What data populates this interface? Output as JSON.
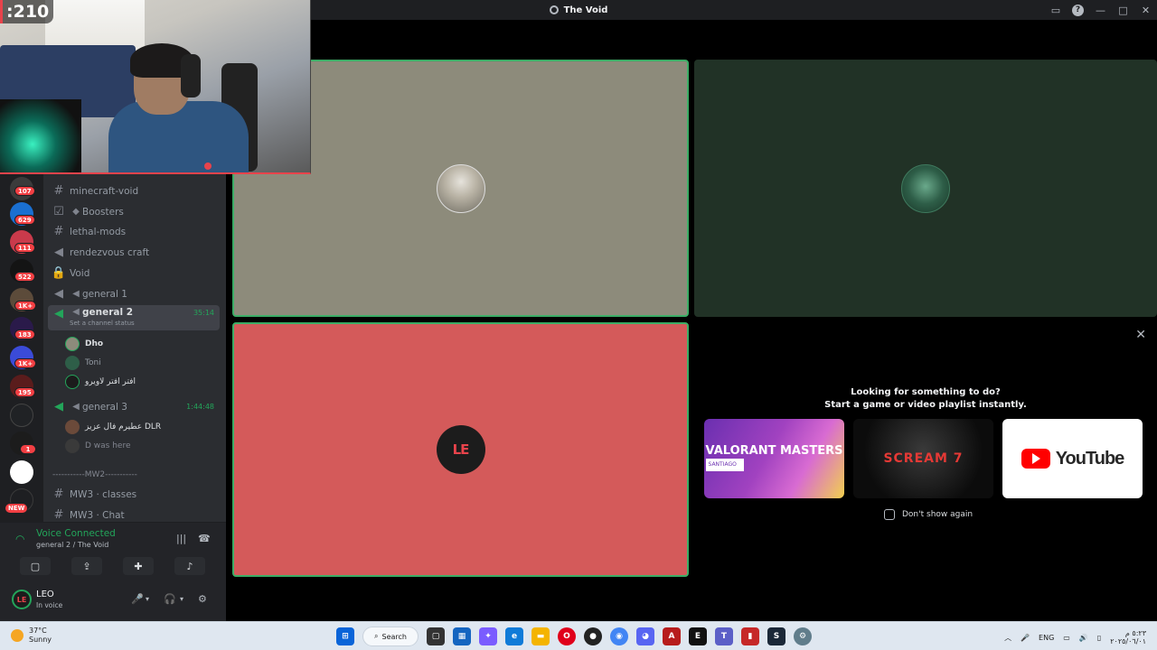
{
  "window": {
    "title": "The Void"
  },
  "stream": {
    "counter": ":210"
  },
  "rail_badges": [
    "107",
    "629",
    "111",
    "522",
    "1K+",
    "183",
    "1K+",
    "195",
    "1",
    "NEW"
  ],
  "channels": {
    "items": [
      {
        "name": "minecraft-void"
      },
      {
        "name": "Boosters"
      },
      {
        "name": "lethal-mods"
      },
      {
        "name": "rendezvous craft"
      },
      {
        "name": "Void"
      },
      {
        "name": "general 1"
      },
      {
        "name": "general 2",
        "status": "Set a channel status",
        "timer": "35:14"
      },
      {
        "name": "general 3",
        "timer": "1:44:48"
      },
      {
        "name": "MW3 · classes"
      },
      {
        "name": "MW3 · Chat"
      }
    ],
    "general2_members": [
      "Dho",
      "Toni",
      "افتر افتر لاويرو"
    ],
    "general3_members": [
      "عطيرم فال عزيز DLR",
      "D was here"
    ],
    "category": "-----------MW2-----------"
  },
  "voice": {
    "title": "Voice Connected",
    "subtitle": "general 2 / The Void"
  },
  "user": {
    "name": "LEO",
    "status": "In voice"
  },
  "tiles": {
    "tile3_avatar": "LE"
  },
  "activity": {
    "line1": "Looking for something to do?",
    "line2": "Start a game or video playlist instantly.",
    "dont_show": "Don't show again",
    "cards": [
      {
        "title": "VALORANT MASTERS",
        "sub": "SANTIAGO"
      },
      {
        "title": "SCREAM",
        "num": "7"
      },
      {
        "title": "YouTube"
      }
    ]
  },
  "taskbar": {
    "temp": "37°C",
    "weather": "Sunny",
    "search": "Search",
    "lang": "ENG"
  }
}
